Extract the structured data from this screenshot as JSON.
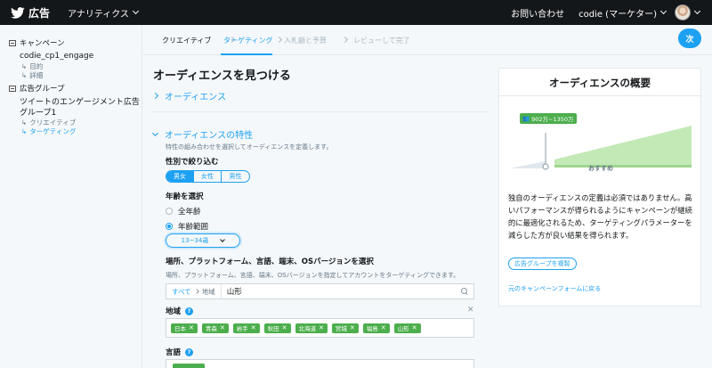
{
  "topbar": {
    "brand_label": "広告",
    "analytics_label": "アナリティクス",
    "contact_label": "お問い合わせ",
    "account_label": "codie (マーケター)"
  },
  "sidebar": {
    "campaign_section": "キャンペーン",
    "campaign_name": "codie_cp1_engage",
    "campaign_subs": [
      "目的",
      "詳細"
    ],
    "adgroup_section": "広告グループ",
    "adgroup_name_line1": "ツイートのエンゲージメント広告",
    "adgroup_name_line2": "グループ1",
    "adgroup_subs": [
      "クリエイティブ",
      "ターゲティング"
    ]
  },
  "stepper": {
    "steps": [
      "クリエイティブ",
      "ターゲティング",
      "入札額と予算",
      "レビューして完了"
    ],
    "next_label": "次"
  },
  "main": {
    "title": "オーディエンスを見つける",
    "audience_label": "オーディエンス",
    "features_label": "オーディエンスの特性",
    "features_help": "特性の組み合わせを選択してオーディエンスを定義します。",
    "gender_label": "性別で絞り込む",
    "gender_options": [
      "男女",
      "女性",
      "男性"
    ],
    "age_label": "年齢を選択",
    "age_all": "全年齢",
    "age_range": "年齢範囲",
    "age_select_value": "13~34歳",
    "location_label": "場所、プラットフォーム、言語、端末、OSバージョンを選択",
    "location_help": "場所、プラットフォーム、言語、端末、OSバージョンを指定してアカウントをターゲティングできます。",
    "crumb_all": "すべて",
    "crumb_region": "地域",
    "location_query": "山形",
    "region_label": "地域",
    "regions": [
      "日本",
      "青森",
      "岩手",
      "秋田",
      "北海道",
      "宮城",
      "福島",
      "山形"
    ],
    "language_label": "言語"
  },
  "card": {
    "title": "オーディエンスの概要",
    "audience_size": "902万~1350万",
    "recommend_label": "おすすめ",
    "description": "独自のオーディエンスの定義は必須ではありません。高いパフォーマンスが得られるようにキャンペーンが継続的に最適化されるため、ターゲティングパラメーターを減らした方が良い結果を得られます。",
    "duplicate_button": "広告グループを複製",
    "back_link": "元のキャンペーンフォームに戻る"
  },
  "colors": {
    "brand_blue": "#1da1f2",
    "chip_green": "#4cae4c",
    "topbar_bg": "#14171a"
  }
}
